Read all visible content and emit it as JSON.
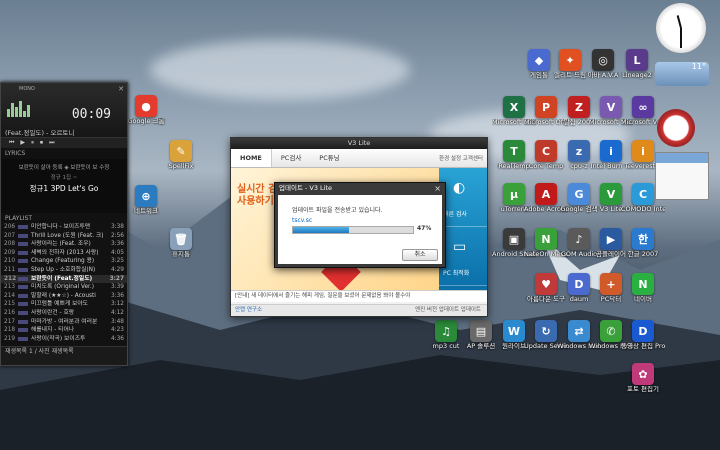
{
  "desktop_icons": [
    {
      "id": "chrome",
      "label": "Google 크롬",
      "color": "#e33b2e",
      "glyph": "●",
      "icon": "chrome-icon"
    },
    {
      "id": "spelling",
      "label": "SpellFix",
      "color": "#d9a23a",
      "glyph": "✎",
      "icon": "folder-icon"
    },
    {
      "id": "network",
      "label": "네트워크",
      "color": "#2a7bc0",
      "glyph": "⊕",
      "icon": "network-icon"
    },
    {
      "id": "trash",
      "label": "휴지통",
      "color": "#8aa0b8",
      "glyph": "🗑",
      "icon": "recycle-bin-icon"
    },
    {
      "id": "game",
      "label": "게임통",
      "color": "#4a6ad0",
      "glyph": "◆",
      "icon": "game-icon"
    },
    {
      "id": "elite",
      "label": "엘리트 드림",
      "color": "#e05020",
      "glyph": "✦",
      "icon": "game-icon"
    },
    {
      "id": "ava",
      "label": "아바 A.V.A",
      "color": "#333333",
      "glyph": "◎",
      "icon": "game-icon"
    },
    {
      "id": "lineage",
      "label": "Lineage2",
      "color": "#5a3a8a",
      "glyph": "L",
      "icon": "game-icon"
    },
    {
      "id": "excel",
      "label": "Microsoft Office Ex",
      "color": "#1e7145",
      "glyph": "X",
      "icon": "excel-icon"
    },
    {
      "id": "ppt",
      "label": "Microsoft Office Po",
      "color": "#d04423",
      "glyph": "P",
      "icon": "powerpoint-icon"
    },
    {
      "id": "alzip",
      "label": "알집 2007",
      "color": "#c02020",
      "glyph": "Z",
      "icon": "archive-icon"
    },
    {
      "id": "vb",
      "label": "Microsoft Visual Bas",
      "color": "#7a5ab0",
      "glyph": "V",
      "icon": "visual-studio-icon"
    },
    {
      "id": "vstudio",
      "label": "Microsoft Visual Stud",
      "color": "#5a3aa0",
      "glyph": "∞",
      "icon": "visual-studio-icon"
    },
    {
      "id": "realtemp",
      "label": "RealTemp",
      "color": "#2a8a3a",
      "glyph": "T",
      "icon": "thermometer-icon"
    },
    {
      "id": "coretemp",
      "label": "Core Temp",
      "color": "#c03a2a",
      "glyph": "C",
      "icon": "thermometer-icon"
    },
    {
      "id": "cpuz",
      "label": "cpu-z",
      "color": "#3a6ab0",
      "glyph": "z",
      "icon": "cpu-icon"
    },
    {
      "id": "intel",
      "label": "Intel Burn Te",
      "color": "#1a6ad0",
      "glyph": "i",
      "icon": "intel-icon"
    },
    {
      "id": "everest",
      "label": "everest",
      "color": "#e08a1a",
      "glyph": "i",
      "icon": "info-icon"
    },
    {
      "id": "utorrent",
      "label": "uTorrent",
      "color": "#3aa03a",
      "glyph": "µ",
      "icon": "torrent-icon"
    },
    {
      "id": "acrobat",
      "label": "Adobe Acrobat",
      "color": "#c01a1a",
      "glyph": "A",
      "icon": "pdf-icon"
    },
    {
      "id": "ggsearch",
      "label": "Google 검색",
      "color": "#4a8ad8",
      "glyph": "G",
      "icon": "search-icon"
    },
    {
      "id": "v3",
      "label": "V3 Lite",
      "color": "#2a9a3a",
      "glyph": "V",
      "icon": "v3-icon"
    },
    {
      "id": "comodo",
      "label": "COMODO Internet",
      "color": "#2a9ad8",
      "glyph": "C",
      "icon": "shield-icon"
    },
    {
      "id": "mobile",
      "label": "Android Studio",
      "color": "#3a3a3a",
      "glyph": "▣",
      "icon": "phone-icon"
    },
    {
      "id": "nateon",
      "label": "NateOn Messenger",
      "color": "#3aa03a",
      "glyph": "N",
      "icon": "chat-icon"
    },
    {
      "id": "gomaudio",
      "label": "GOM Audio",
      "color": "#5a5a5a",
      "glyph": "♪",
      "icon": "audio-icon"
    },
    {
      "id": "gomplayer",
      "label": "곰플레이어",
      "color": "#2a5aa0",
      "glyph": "▶",
      "icon": "video-icon"
    },
    {
      "id": "hangul",
      "label": "한글 2007",
      "color": "#2a7ad0",
      "glyph": "한",
      "icon": "document-icon"
    },
    {
      "id": "thanks",
      "label": "아름다운 도구",
      "color": "#c03a3a",
      "glyph": "♥",
      "icon": "tool-icon"
    },
    {
      "id": "daum",
      "label": "daum",
      "color": "#4a6ad0",
      "glyph": "D",
      "icon": "daum-icon"
    },
    {
      "id": "pcdoctor",
      "label": "PC닥터",
      "color": "#d05a2a",
      "glyph": "+",
      "icon": "doctor-icon"
    },
    {
      "id": "naver",
      "label": "네이버",
      "color": "#2ab040",
      "glyph": "N",
      "icon": "naver-icon"
    },
    {
      "id": "mp3",
      "label": "mp3 cut",
      "color": "#2a8a3a",
      "glyph": "♫",
      "icon": "audio-icon"
    },
    {
      "id": "apc",
      "label": "AP 솔루션",
      "color": "#6a6a6a",
      "glyph": "▤",
      "icon": "app-icon"
    },
    {
      "id": "winlive",
      "label": "원라이브",
      "color": "#2a8ad0",
      "glyph": "W",
      "icon": "windows-icon"
    },
    {
      "id": "update",
      "label": "Update Service",
      "color": "#3a6ab0",
      "glyph": "↻",
      "icon": "update-icon"
    },
    {
      "id": "mobilesync",
      "label": "Windows Mobile",
      "color": "#3a8ad0",
      "glyph": "⇄",
      "icon": "sync-icon"
    },
    {
      "id": "winphone",
      "label": "Windows Mobile",
      "color": "#3aa03a",
      "glyph": "✆",
      "icon": "phone-icon"
    },
    {
      "id": "pbd",
      "label": "동영상 편집 Pro",
      "color": "#1a5ad0",
      "glyph": "D",
      "icon": "video-icon"
    },
    {
      "id": "photo",
      "label": "포토 편집기",
      "color": "#c03a7a",
      "glyph": "✿",
      "icon": "photo-icon"
    }
  ],
  "player": {
    "mode": "MONO",
    "time": "00:09",
    "title": "(Feat.정일도) - 오르토니",
    "lyrics_header": "LYRICS",
    "lyrics": [
      "보란듯이 살아 등록    ◈ 보란듯이 보 수정",
      "정규 1집 ~",
      "정규1 3PD Let's Go"
    ],
    "playlist_header": "PLAYLIST",
    "rows": [
      {
        "n": "206",
        "t": "미안합니다 - 보이즈투맨",
        "d": "3:38"
      },
      {
        "n": "207",
        "t": "Thrill Love (도원 (Feat. 크)",
        "d": "2:56"
      },
      {
        "n": "208",
        "t": "사랑이라는 (Feat. 조우)",
        "d": "3:36"
      },
      {
        "n": "209",
        "t": "새벽의 전하자 (2013 사랑)",
        "d": "4:05"
      },
      {
        "n": "210",
        "t": "Change (Featuring 용)",
        "d": "3:25"
      },
      {
        "n": "211",
        "t": "Step Up - 소호화합실(N)",
        "d": "4:29"
      },
      {
        "n": "212",
        "t": "보란듯이 (Feat.정일도)",
        "d": "3:27",
        "active": true
      },
      {
        "n": "213",
        "t": "미치도록 (Original Ver.)",
        "d": "3:39"
      },
      {
        "n": "214",
        "t": "말할래 (★★☆) - Acousti",
        "d": "3:36"
      },
      {
        "n": "215",
        "t": "미끄럼틀 예쁘게 보아도",
        "d": "3:12"
      },
      {
        "n": "216",
        "t": "사랑이란건 - 호랑",
        "d": "4:12"
      },
      {
        "n": "217",
        "t": "마마가방 - 여러분과 여러분",
        "d": "3:48"
      },
      {
        "n": "218",
        "t": "해를내지 - 티어나",
        "d": "4:23"
      },
      {
        "n": "219",
        "t": "사랑이(작곡) 보이즈투",
        "d": "4:36"
      }
    ],
    "footer": "재생목록 1 / 사진 재생목록"
  },
  "v3": {
    "title": "V3 Lite",
    "tabs": [
      "HOME",
      "PC검사",
      "PC튜닝"
    ],
    "nav_right": "환경 설정   고객센터",
    "banner_line1": "실시간 검",
    "banner_line2": "사용하기",
    "side_buttons": [
      "빠른 검사",
      "PC 최적화"
    ],
    "promo": "[안내] 새 데이터에서 즐기는 해피 게임, 질문을 보셨어 문제없음 봐야 볼수야",
    "footer": "엔진 버전   업데이트   업데이트",
    "brand": "안랩 연구소"
  },
  "dialog": {
    "title": "업데이트 - V3 Lite",
    "message": "업데이트 파일을 전송받고 있습니다.",
    "file": "tscv.sc",
    "progress": 0.47,
    "percent": "47%",
    "cancel": "취소"
  },
  "widgets": {
    "weather_temp": "11°",
    "clock_hour": 11,
    "clock_minute": 30
  },
  "colors": {
    "accent": "#1f78c0",
    "v3_side": "#0a6fa8",
    "player_bg": "#1c1c1c"
  }
}
